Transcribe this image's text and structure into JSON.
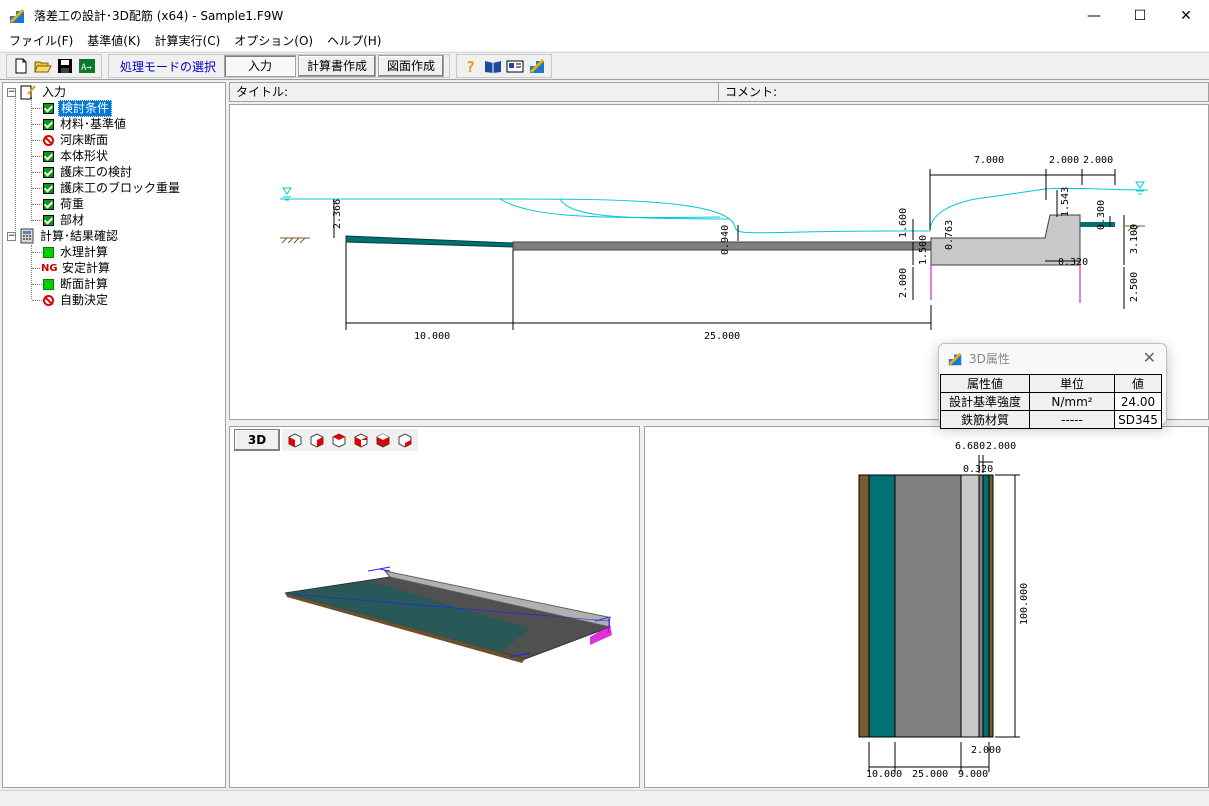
{
  "window": {
    "title": "落差工の設計･3D配筋 (x64) - Sample1.F9W",
    "controls": {
      "minimize": "—",
      "maximize": "☐",
      "close": "✕"
    }
  },
  "menu": {
    "items": [
      "ファイル(F)",
      "基準値(K)",
      "計算実行(C)",
      "オプション(O)",
      "ヘルプ(H)"
    ]
  },
  "toolbar": {
    "mode_label": "処理モードの選択",
    "mode_input": "入力",
    "mode_report": "計算書作成",
    "mode_drawing": "図面作成",
    "icons": [
      "new-file-icon",
      "open-folder-icon",
      "save-icon",
      "export-icon",
      "help-icon",
      "book-icon",
      "id-card-icon",
      "app-logo-icon"
    ]
  },
  "tree": {
    "input_root": "入力",
    "input_items": [
      {
        "label": "検討条件",
        "status": "checked",
        "selected": true
      },
      {
        "label": "材料･基準値",
        "status": "checked"
      },
      {
        "label": "河床断面",
        "status": "none"
      },
      {
        "label": "本体形状",
        "status": "checked"
      },
      {
        "label": "護床工の検討",
        "status": "checked"
      },
      {
        "label": "護床工のブロック重量",
        "status": "checked"
      },
      {
        "label": "荷重",
        "status": "checked"
      },
      {
        "label": "部材",
        "status": "checked"
      }
    ],
    "calc_root": "計算･結果確認",
    "calc_items": [
      {
        "label": "水理計算",
        "status": "ok"
      },
      {
        "label": "安定計算",
        "status": "ng",
        "badge": "NG"
      },
      {
        "label": "断面計算",
        "status": "ok"
      },
      {
        "label": "自動決定",
        "status": "none"
      }
    ]
  },
  "infobar": {
    "title_label": "タイトル:",
    "comment_label": "コメント:"
  },
  "section_view": {
    "dims": {
      "d7000": "7.000",
      "d2000a": "2.000",
      "d2000b": "2.000",
      "d2366": "2.366",
      "d1543": "1.543",
      "d0300": "0.300",
      "d3100": "3.100",
      "d0940": "0.940",
      "d1600": "1.600",
      "d0763": "0.763",
      "d1500": "1.500",
      "d0320": "0.320",
      "d2000c": "2.000",
      "d2500": "2.500",
      "d10000": "10.000",
      "d25000": "25.000"
    }
  },
  "view3d": {
    "button": "3D",
    "cube_icons": 6
  },
  "plan_view": {
    "dims": {
      "d6680": "6.680",
      "d2000top": "2.000",
      "d0320": "0.320",
      "d100000": "100.000",
      "d2000bot": "2.000",
      "d10000": "10.000",
      "d25000": "25.000",
      "d9000": "9.000"
    }
  },
  "popup": {
    "title": "3D属性",
    "close": "✕",
    "headers": [
      "属性値",
      "単位",
      "値"
    ],
    "rows": [
      [
        "設計基準強度",
        "N/mm²",
        "24.00"
      ],
      [
        "鉄筋材質",
        "-----",
        "SD345"
      ]
    ]
  },
  "colors": {
    "water": "#00c8d8",
    "apron": "#007070",
    "concrete": "#808080",
    "soil": "#7a5a32",
    "pile": "#c000c0",
    "selection": "#0078d7"
  }
}
